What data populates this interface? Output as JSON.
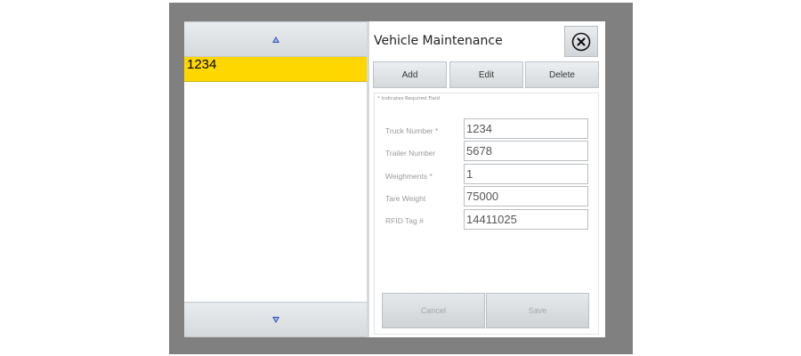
{
  "list": {
    "items": [
      {
        "label": "1234",
        "selected": true
      }
    ],
    "scroll_up_icon": "triangle-up-icon",
    "scroll_down_icon": "triangle-down-icon"
  },
  "header": {
    "title": "Vehicle Maintenance",
    "close_icon": "close-circle-icon"
  },
  "toolbar": {
    "add_label": "Add",
    "edit_label": "Edit",
    "delete_label": "Delete"
  },
  "form": {
    "required_note": "* Indicates Required Field",
    "fields": [
      {
        "label": "Truck Number *",
        "value": "1234"
      },
      {
        "label": "Trailer Number",
        "value": "5678"
      },
      {
        "label": "Weighments *",
        "value": "1"
      },
      {
        "label": "Tare Weight",
        "value": "75000"
      },
      {
        "label": "RFID Tag #",
        "value": "14411025"
      }
    ],
    "cancel_label": "Cancel",
    "save_label": "Save"
  },
  "colors": {
    "selected_item": "#ffd700",
    "frame": "#808080",
    "arrow": "#2a52be"
  }
}
